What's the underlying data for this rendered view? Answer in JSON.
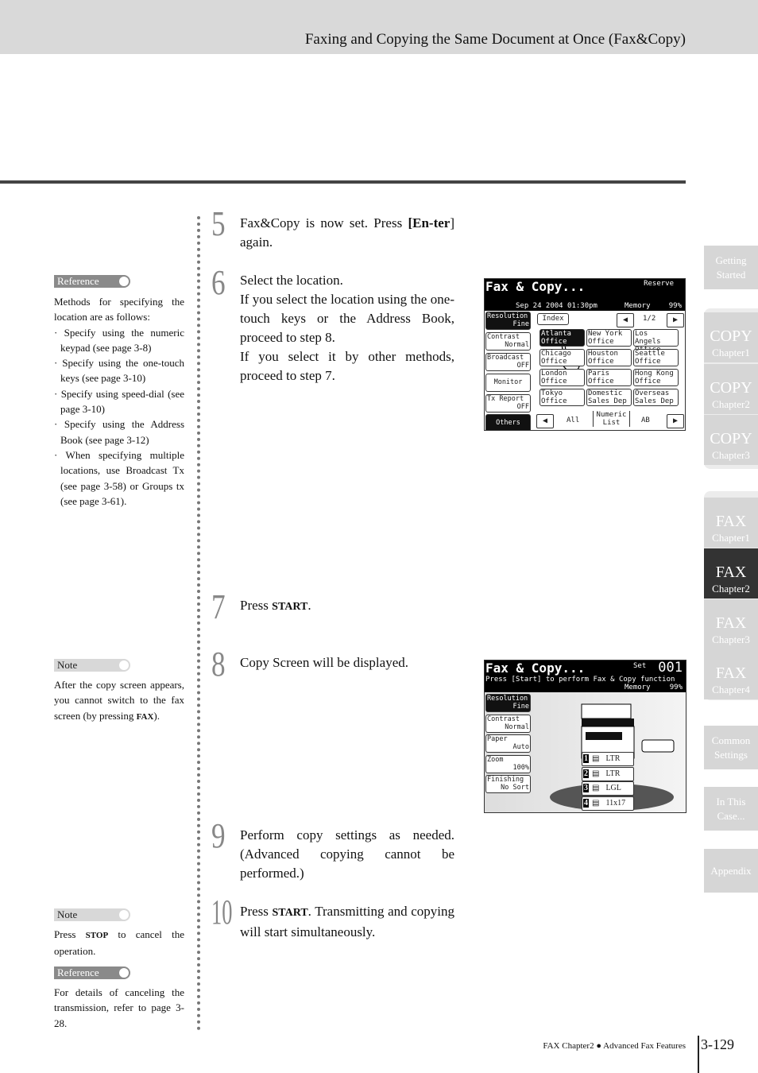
{
  "header": {
    "title": "Faxing and Copying the Same Document at Once (Fax&Copy)"
  },
  "steps": [
    {
      "num": "5",
      "text_a": "Fax&Copy is now set. Press ",
      "bold": "[En-ter",
      "text_b": "] again."
    },
    {
      "num": "6",
      "lines": "Select the location.\nIf you select the location using the one-touch keys or the Address Book, proceed to step 8.\nIf you select it by other methods, proceed to step 7."
    },
    {
      "num": "7",
      "text_a": "Press ",
      "sc": "START",
      "text_b": "."
    },
    {
      "num": "8",
      "text": "Copy Screen will be displayed."
    },
    {
      "num": "9",
      "text": "Perform copy settings as needed. (Advanced copying cannot be performed.)"
    },
    {
      "num": "10",
      "text_a": "Press ",
      "sc": "START",
      "text_b": ". Transmitting and copying will start simultaneously."
    }
  ],
  "sidenotes": {
    "ref1_label": "Reference",
    "ref1_text": "Methods for specifying the location are as follows:",
    "ref1_items": [
      "· Specify using the numeric keypad (see page 3-8)",
      "· Specify using the one-touch keys (see page 3-10)",
      "· Specify using speed-dial (see page 3-10)",
      "· Specify using the Address Book (see page 3-12)",
      "· When specifying multiple locations, use Broadcast Tx (see page 3-58) or Groups tx (see page 3-61)."
    ],
    "note1_label": "Note",
    "note1_text_a": "After the copy screen appears, you cannot switch to the fax screen (by pressing ",
    "note1_sc": "FAX",
    "note1_text_b": ").",
    "note2_label": "Note",
    "note2_text_a": "Press ",
    "note2_sc": "STOP",
    "note2_text_b": " to cancel the operation.",
    "ref2_label": "Reference",
    "ref2_text": "For details of canceling the transmission, refer to page 3-28."
  },
  "screen1": {
    "title": "Fax & Copy...",
    "reserve": "Reserve",
    "date": "Sep 24 2004 01:30pm",
    "memory": "Memory",
    "memory_val": "99%",
    "left": [
      {
        "l": "Resolution",
        "v": "Fine"
      },
      {
        "l": "Contrast",
        "v": "Normal"
      },
      {
        "l": "Broadcast",
        "v": "OFF"
      },
      {
        "l": "Monitor",
        "v": ""
      },
      {
        "l": "Tx Report",
        "v": "OFF"
      }
    ],
    "others": "Others",
    "index": "Index",
    "page": "1/2",
    "keys": [
      [
        "Atlanta",
        "Office"
      ],
      [
        "New York",
        "Office"
      ],
      [
        "Los Angels",
        "Office"
      ],
      [
        "Chicago",
        "Office"
      ],
      [
        "Houston",
        "Office"
      ],
      [
        "Seattle",
        "Office"
      ],
      [
        "London",
        "Office"
      ],
      [
        "Paris",
        "Office"
      ],
      [
        "Hong Kong",
        "Office"
      ],
      [
        "Tokyo",
        "Office"
      ],
      [
        "Domestic",
        "Sales Dep"
      ],
      [
        "Overseas",
        "Sales Dep"
      ]
    ],
    "bottom": [
      "All",
      "Numeric List",
      "AB"
    ]
  },
  "screen2": {
    "title": "Fax & Copy...",
    "set": "Set",
    "count": "001",
    "msg": "Press [Start] to perform Fax & Copy function",
    "memory": "Memory",
    "memory_val": "99%",
    "left": [
      {
        "l": "Resolution",
        "v": "Fine"
      },
      {
        "l": "Contrast",
        "v": "Normal"
      },
      {
        "l": "Paper",
        "v": "Auto"
      },
      {
        "l": "Zoom",
        "v": "100%"
      },
      {
        "l": "Finishing",
        "v": "No Sort"
      }
    ],
    "trays": [
      {
        "n": "1",
        "s": "LTR"
      },
      {
        "n": "2",
        "s": "LTR"
      },
      {
        "n": "3",
        "s": "LGL"
      },
      {
        "n": "4",
        "s": "11x17"
      }
    ]
  },
  "tabs": [
    {
      "a": "Getting",
      "b": "Started"
    },
    {
      "a": "COPY",
      "b": "Chapter1"
    },
    {
      "a": "COPY",
      "b": "Chapter2"
    },
    {
      "a": "COPY",
      "b": "Chapter3"
    },
    {
      "a": "FAX",
      "b": "Chapter1"
    },
    {
      "a": "FAX",
      "b": "Chapter2",
      "active": true
    },
    {
      "a": "FAX",
      "b": "Chapter3"
    },
    {
      "a": "FAX",
      "b": "Chapter4"
    },
    {
      "a": "Common",
      "b": "Settings"
    },
    {
      "a": "In This",
      "b": "Case..."
    },
    {
      "a": "Appendix",
      "b": ""
    }
  ],
  "footer": {
    "chapter": "FAX Chapter2",
    "section": "Advanced Fax Features",
    "page": "3-129"
  }
}
